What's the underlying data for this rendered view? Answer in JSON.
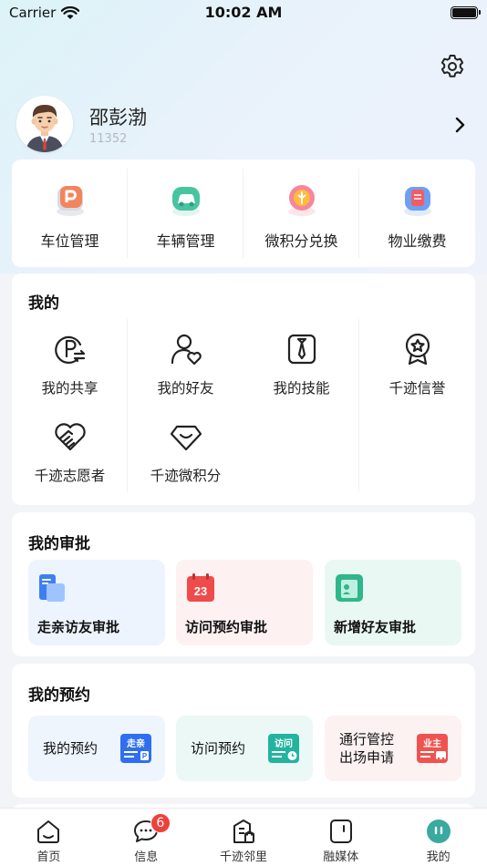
{
  "status_bar": {
    "carrier": "Carrier",
    "time": "10:02 AM"
  },
  "profile": {
    "name": "邵彭渤",
    "id": "11352"
  },
  "quick_actions": [
    {
      "label": "车位管理",
      "icon": "parking-icon"
    },
    {
      "label": "车辆管理",
      "icon": "car-icon"
    },
    {
      "label": "微积分兑换",
      "icon": "points-exchange-icon"
    },
    {
      "label": "物业缴费",
      "icon": "property-fee-icon"
    }
  ],
  "mine": {
    "title": "我的",
    "items": [
      {
        "label": "我的共享",
        "icon": "parking-share-icon"
      },
      {
        "label": "我的好友",
        "icon": "friend-heart-icon"
      },
      {
        "label": "我的技能",
        "icon": "tie-icon"
      },
      {
        "label": "千迹信誉",
        "icon": "medal-icon"
      },
      {
        "label": "千迹志愿者",
        "icon": "handshake-heart-icon"
      },
      {
        "label": "千迹微积分",
        "icon": "diamond-icon"
      }
    ]
  },
  "approval": {
    "title": "我的审批",
    "items": [
      {
        "label": "走亲访友审批",
        "icon": "document-blue-icon"
      },
      {
        "label": "访问预约审批",
        "icon": "calendar-icon",
        "calendar_day": "23"
      },
      {
        "label": "新增好友审批",
        "icon": "contact-card-icon"
      }
    ]
  },
  "booking": {
    "title": "我的预约",
    "items": [
      {
        "label": "我的预约",
        "icon": "visit-relatives-icon",
        "icon_text": "走亲"
      },
      {
        "label": "访问预约",
        "icon": "visit-icon",
        "icon_text": "访问"
      },
      {
        "label_line1": "通行管控",
        "label_line2": "出场申请",
        "icon": "owner-icon",
        "icon_text": "业主"
      }
    ]
  },
  "tabbar": {
    "items": [
      {
        "label": "首页",
        "icon": "home-icon"
      },
      {
        "label": "信息",
        "icon": "message-icon",
        "badge": "6"
      },
      {
        "label": "千迹邻里",
        "icon": "neighbor-icon"
      },
      {
        "label": "融媒体",
        "icon": "media-icon"
      },
      {
        "label": "我的",
        "icon": "profile-icon",
        "active": true
      }
    ]
  },
  "colors": {
    "accent_teal": "#3aa99f",
    "badge_red": "#f0403c"
  }
}
